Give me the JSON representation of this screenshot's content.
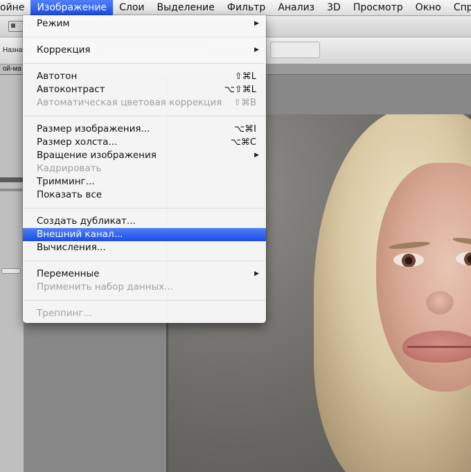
{
  "menubar": {
    "items": [
      "ойне",
      "Изображение",
      "Слои",
      "Выделение",
      "Фильтр",
      "Анализ",
      "3D",
      "Просмотр",
      "Окно",
      "Справка"
    ]
  },
  "optionsbar": {
    "label": "Назнач"
  },
  "document": {
    "tab_label": "ой-ма"
  },
  "menu": {
    "items": [
      {
        "label": "Режим",
        "shortcut": "",
        "submenu": true,
        "disabled": false
      },
      {
        "label": "Коррекция",
        "shortcut": "",
        "submenu": true,
        "disabled": false
      },
      {
        "label": "Автотон",
        "shortcut": "⇧⌘L",
        "submenu": false,
        "disabled": false
      },
      {
        "label": "Автоконтраст",
        "shortcut": "⌥⇧⌘L",
        "submenu": false,
        "disabled": false
      },
      {
        "label": "Автоматическая цветовая коррекция",
        "shortcut": "⇧⌘B",
        "submenu": false,
        "disabled": true
      },
      {
        "label": "Размер изображения...",
        "shortcut": "⌥⌘I",
        "submenu": false,
        "disabled": false
      },
      {
        "label": "Размер холста...",
        "shortcut": "⌥⌘C",
        "submenu": false,
        "disabled": false
      },
      {
        "label": "Вращение изображения",
        "shortcut": "",
        "submenu": true,
        "disabled": false
      },
      {
        "label": "Кадрировать",
        "shortcut": "",
        "submenu": false,
        "disabled": true
      },
      {
        "label": "Тримминг...",
        "shortcut": "",
        "submenu": false,
        "disabled": false
      },
      {
        "label": "Показать все",
        "shortcut": "",
        "submenu": false,
        "disabled": false
      },
      {
        "label": "Создать дубликат...",
        "shortcut": "",
        "submenu": false,
        "disabled": false
      },
      {
        "label": "Внешний канал...",
        "shortcut": "",
        "submenu": false,
        "disabled": false,
        "selected": true
      },
      {
        "label": "Вычисления...",
        "shortcut": "",
        "submenu": false,
        "disabled": false
      },
      {
        "label": "Переменные",
        "shortcut": "",
        "submenu": true,
        "disabled": false
      },
      {
        "label": "Применить набор данных...",
        "shortcut": "",
        "submenu": false,
        "disabled": true
      },
      {
        "label": "Треппинг...",
        "shortcut": "",
        "submenu": false,
        "disabled": true
      }
    ]
  },
  "colors": {
    "menu_highlight": "#1d4fe9",
    "disabled_text": "#a0a0a0"
  },
  "icons": {
    "submenu_arrow": "submenu-arrow-icon"
  }
}
